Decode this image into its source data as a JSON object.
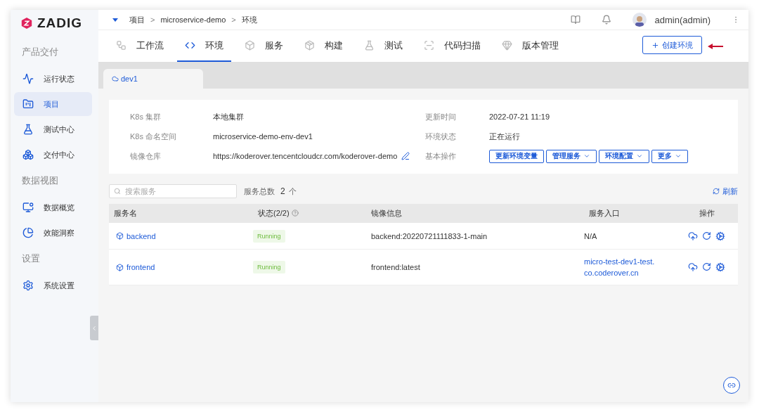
{
  "logo": {
    "text": "ZADIG"
  },
  "sidebar": {
    "sections": [
      {
        "title": "产品交付",
        "items": [
          {
            "label": "运行状态",
            "selected": false
          },
          {
            "label": "项目",
            "selected": true
          },
          {
            "label": "测试中心",
            "selected": false
          },
          {
            "label": "交付中心",
            "selected": false
          }
        ]
      },
      {
        "title": "数据视图",
        "items": [
          {
            "label": "数据概览",
            "selected": false
          },
          {
            "label": "效能洞察",
            "selected": false
          }
        ]
      },
      {
        "title": "设置",
        "items": [
          {
            "label": "系统设置",
            "selected": false
          }
        ]
      }
    ]
  },
  "breadcrumb": [
    {
      "kind": "item",
      "text": "项目"
    },
    {
      "kind": "separator",
      "text": ">"
    },
    {
      "kind": "item",
      "text": "microservice-demo"
    },
    {
      "kind": "separator",
      "text": ">"
    },
    {
      "kind": "item",
      "text": "环境"
    }
  ],
  "user": {
    "name": "admin(admin)"
  },
  "tabs": [
    {
      "label": "工作流",
      "selected": false
    },
    {
      "label": "环境",
      "selected": true
    },
    {
      "label": "服务",
      "selected": false
    },
    {
      "label": "构建",
      "selected": false
    },
    {
      "label": "测试",
      "selected": false
    },
    {
      "label": "代码扫描",
      "selected": false
    },
    {
      "label": "版本管理",
      "selected": false
    }
  ],
  "create_button": "创建环境",
  "env_tabs": [
    {
      "label": "dev1",
      "selected": true
    }
  ],
  "info": {
    "left": [
      {
        "label": "K8s 集群",
        "value": "本地集群"
      },
      {
        "label": "K8s 命名空间",
        "value": "microservice-demo-env-dev1"
      },
      {
        "label": "镜像仓库",
        "value": "https://koderover.tencentcloudcr.com/koderover-demo",
        "editable": true
      }
    ],
    "right": [
      {
        "label": "更新时间",
        "value": "2022-07-21 11:19"
      },
      {
        "label": "环境状态",
        "value": "正在运行"
      },
      {
        "label": "基本操作",
        "actions": [
          {
            "label": "更新环境变量",
            "dropdown": false
          },
          {
            "label": "管理服务",
            "dropdown": true
          },
          {
            "label": "环境配置",
            "dropdown": true
          },
          {
            "label": "更多",
            "dropdown": true
          }
        ]
      }
    ]
  },
  "search": {
    "placeholder": "搜索服务"
  },
  "count": {
    "label": "服务总数",
    "value": "2",
    "unit": "个"
  },
  "refresh": "刷新",
  "table": {
    "columns": [
      "服务名",
      "状态(2/2)",
      "镜像信息",
      "服务入口",
      "操作"
    ],
    "rows": [
      {
        "name": "backend",
        "status": "Running",
        "image": "backend:20220721111833-1-main",
        "entry": {
          "lines": [
            "N/A"
          ],
          "link": false
        }
      },
      {
        "name": "frontend",
        "status": "Running",
        "image": "frontend:latest",
        "entry": {
          "lines": [
            "micro-test-dev1-test.",
            "co.coderover.cn"
          ],
          "link": true
        }
      }
    ]
  }
}
